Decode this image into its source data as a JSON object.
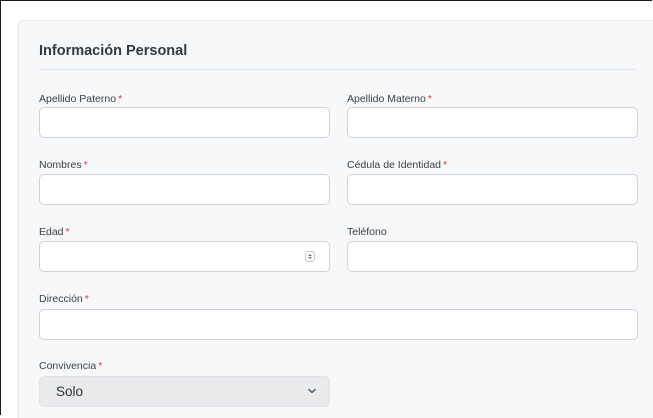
{
  "section": {
    "title": "Información Personal"
  },
  "required_marker": "*",
  "fields": {
    "apellido_paterno": {
      "label": "Apellido Paterno",
      "value": ""
    },
    "apellido_materno": {
      "label": "Apellido Materno",
      "value": ""
    },
    "nombres": {
      "label": "Nombres",
      "value": ""
    },
    "cedula": {
      "label": "Cédula de Identidad",
      "value": ""
    },
    "edad": {
      "label": "Edad",
      "value": ""
    },
    "telefono": {
      "label": "Teléfono",
      "value": ""
    },
    "direccion": {
      "label": "Dirección",
      "value": ""
    },
    "convivencia": {
      "label": "Convivencia",
      "selected": "Solo"
    }
  },
  "icons": {
    "number_spinner": "spinner-icon",
    "select_chevron": "chevron-down-icon"
  },
  "colors": {
    "required": "#dc3545",
    "card_background": "#f7f8fa",
    "select_background": "#e9eaec",
    "input_border": "#ced4da"
  }
}
